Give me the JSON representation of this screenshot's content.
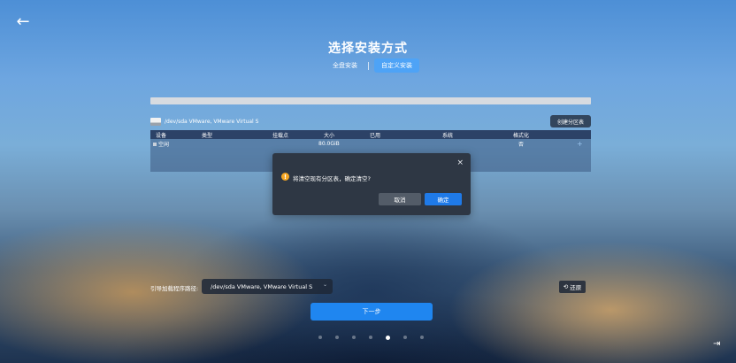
{
  "nav": {
    "back_icon": "arrow-left-icon",
    "back_glyph": "←"
  },
  "title": "选择安装方式",
  "mode_tabs": [
    {
      "label": "全盘安装",
      "active": false
    },
    {
      "label": "自定义安装",
      "active": true
    }
  ],
  "disk": {
    "name": "/dev/sda VMware, VMware Virtual S",
    "icon": "disk-icon",
    "create_table_label": "创建分区表"
  },
  "table": {
    "headers": [
      "设备",
      "类型",
      "挂载点",
      "大小",
      "已用",
      "系统",
      "格式化"
    ],
    "rows": [
      {
        "device": "空闲",
        "type": "",
        "mount": "",
        "size": "80.0GiB",
        "used": "",
        "system": "",
        "format": "否"
      }
    ],
    "add_icon": "plus-icon"
  },
  "dialog": {
    "close_glyph": "×",
    "warning_icon": "warning-icon",
    "warning_glyph": "!",
    "message": "将清空现有分区表，确定清空?",
    "cancel_label": "取消",
    "ok_label": "确定"
  },
  "boot": {
    "label": "引导加载程序路径:",
    "selected": "/dev/sda VMware, VMware Virtual S",
    "chevron": "chevron-down-icon"
  },
  "restore": {
    "icon": "restore-icon",
    "label": "还原"
  },
  "next_label": "下一步",
  "pagination": {
    "count": 7,
    "active_index": 4
  },
  "exit_icon": "exit-icon",
  "colors": {
    "accent": "#1f86f0",
    "active_tab": "#4ea3f6",
    "warning": "#f5a623",
    "dialog_bg": "#2e3744"
  }
}
